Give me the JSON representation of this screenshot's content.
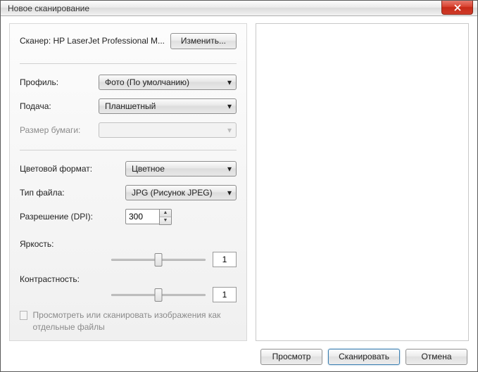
{
  "window": {
    "title": "Новое сканирование"
  },
  "scanner": {
    "label": "Сканер: HP LaserJet Professional M...",
    "change_btn": "Изменить..."
  },
  "profile": {
    "label": "Профиль:",
    "value": "Фото (По умолчанию)"
  },
  "feed": {
    "label": "Подача:",
    "value": "Планшетный"
  },
  "paper": {
    "label": "Размер бумаги:",
    "value": ""
  },
  "color": {
    "label": "Цветовой формат:",
    "value": "Цветное"
  },
  "filetype": {
    "label": "Тип файла:",
    "value": "JPG (Рисунок JPEG)"
  },
  "dpi": {
    "label": "Разрешение (DPI):",
    "value": "300"
  },
  "brightness": {
    "label": "Яркость:",
    "value": "1"
  },
  "contrast": {
    "label": "Контрастность:",
    "value": "1"
  },
  "preview_files": {
    "label": "Просмотреть или сканировать изображения как отдельные файлы"
  },
  "footer": {
    "preview": "Просмотр",
    "scan": "Сканировать",
    "cancel": "Отмена"
  }
}
